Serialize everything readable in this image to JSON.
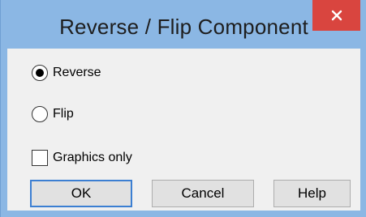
{
  "window": {
    "title": "Reverse / Flip Component",
    "close_glyph": "×"
  },
  "options": {
    "reverse_label": "Reverse",
    "reverse_checked": true,
    "flip_label": "Flip",
    "flip_checked": false,
    "graphics_only_label": "Graphics only",
    "graphics_only_checked": false
  },
  "buttons": {
    "ok_label": "OK",
    "cancel_label": "Cancel",
    "help_label": "Help"
  },
  "colors": {
    "titlebar": "#8bb7e4",
    "close_button": "#d9453f",
    "default_button_border": "#3c7fd2"
  }
}
